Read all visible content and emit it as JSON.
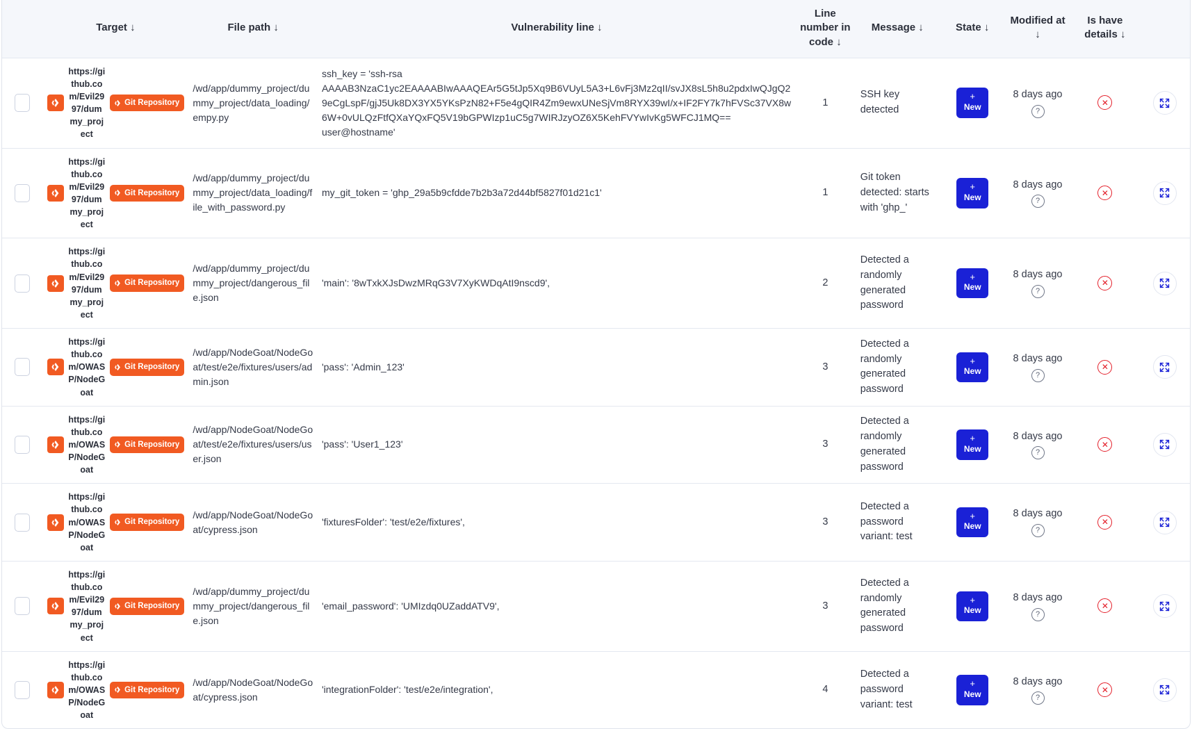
{
  "table": {
    "columns": [
      {
        "key": "select",
        "label": "",
        "sort": ""
      },
      {
        "key": "target",
        "label": "Target",
        "sort": "↓"
      },
      {
        "key": "file_path",
        "label": "File path",
        "sort": "↓"
      },
      {
        "key": "vulnerability_line",
        "label": "Vulnerability line",
        "sort": "↓"
      },
      {
        "key": "line_number",
        "label": "Line number in code",
        "sort": "↓"
      },
      {
        "key": "message",
        "label": "Message",
        "sort": "↓"
      },
      {
        "key": "state",
        "label": "State",
        "sort": "↓"
      },
      {
        "key": "modified_at",
        "label": "Modified at",
        "sort": "↓"
      },
      {
        "key": "is_have_details",
        "label": "Is have details",
        "sort": "↓"
      },
      {
        "key": "expand",
        "label": "",
        "sort": ""
      }
    ],
    "badges": {
      "repository_label": "Git Repository",
      "state_label": "New",
      "state_plus": "+"
    },
    "colors": {
      "accent_orange": "#f15a22",
      "state_blue": "#1a21d6",
      "danger_red": "#e4202b",
      "header_bg": "#f5f7fb",
      "border": "#e4e8f0"
    },
    "rows": [
      {
        "target_url": "https://github.com/Evil2997/dummy_project",
        "repository": "Git Repository",
        "file_path": "/wd/app/dummy_project/dummy_project/data_loading/empy.py",
        "vulnerability_line": "ssh_key = 'ssh-rsa AAAAB3NzaC1yc2EAAAABIwAAAQEAr5G5tJp5Xq9B6VUyL5A3+L6vFj3Mz2qII/svJX8sL5h8u2pdxIwQJgQ29eCgLspF/gjJ5Uk8DX3YX5YKsPzN82+F5e4gQIR4Zm9ewxUNeSjVm8RYX39wI/x+IF2FY7k7hFVSc37VX8w6W+0vULQzFtfQXaYQxFQ5V19bGPWIzp1uC5g7WIRJzyOZ6X5KehFVYwIvKg5WFCJ1MQ== user@hostname'",
        "line_number": "1",
        "message": "SSH key detected",
        "state": "New",
        "modified_at": "8 days ago",
        "is_have_details": "no"
      },
      {
        "target_url": "https://github.com/Evil2997/dummy_project",
        "repository": "Git Repository",
        "file_path": "/wd/app/dummy_project/dummy_project/data_loading/file_with_password.py",
        "vulnerability_line": "my_git_token = 'ghp_29a5b9cfdde7b2b3a72d44bf5827f01d21c1'",
        "line_number": "1",
        "message": "Git token detected: starts with 'ghp_'",
        "state": "New",
        "modified_at": "8 days ago",
        "is_have_details": "no"
      },
      {
        "target_url": "https://github.com/Evil2997/dummy_project",
        "repository": "Git Repository",
        "file_path": "/wd/app/dummy_project/dummy_project/dangerous_file.json",
        "vulnerability_line": "'main': '8wTxkXJsDwzMRqG3V7XyKWDqAtI9nscd9',",
        "line_number": "2",
        "message": "Detected a randomly generated password",
        "state": "New",
        "modified_at": "8 days ago",
        "is_have_details": "no"
      },
      {
        "target_url": "https://github.com/OWASP/NodeGoat",
        "repository": "Git Repository",
        "file_path": "/wd/app/NodeGoat/NodeGoat/test/e2e/fixtures/users/admin.json",
        "vulnerability_line": "'pass': 'Admin_123'",
        "line_number": "3",
        "message": "Detected a randomly generated password",
        "state": "New",
        "modified_at": "8 days ago",
        "is_have_details": "no"
      },
      {
        "target_url": "https://github.com/OWASP/NodeGoat",
        "repository": "Git Repository",
        "file_path": "/wd/app/NodeGoat/NodeGoat/test/e2e/fixtures/users/user.json",
        "vulnerability_line": "'pass': 'User1_123'",
        "line_number": "3",
        "message": "Detected a randomly generated password",
        "state": "New",
        "modified_at": "8 days ago",
        "is_have_details": "no"
      },
      {
        "target_url": "https://github.com/OWASP/NodeGoat",
        "repository": "Git Repository",
        "file_path": "/wd/app/NodeGoat/NodeGoat/cypress.json",
        "vulnerability_line": "'fixturesFolder': 'test/e2e/fixtures',",
        "line_number": "3",
        "message": "Detected a password variant: test",
        "state": "New",
        "modified_at": "8 days ago",
        "is_have_details": "no"
      },
      {
        "target_url": "https://github.com/Evil2997/dummy_project",
        "repository": "Git Repository",
        "file_path": "/wd/app/dummy_project/dummy_project/dangerous_file.json",
        "vulnerability_line": "'email_password': 'UMIzdq0UZaddATV9',",
        "line_number": "3",
        "message": "Detected a randomly generated password",
        "state": "New",
        "modified_at": "8 days ago",
        "is_have_details": "no"
      },
      {
        "target_url": "https://github.com/OWASP/NodeGoat",
        "repository": "Git Repository",
        "file_path": "/wd/app/NodeGoat/NodeGoat/cypress.json",
        "vulnerability_line": "'integrationFolder': 'test/e2e/integration',",
        "line_number": "4",
        "message": "Detected a password variant: test",
        "state": "New",
        "modified_at": "8 days ago",
        "is_have_details": "no"
      }
    ]
  }
}
